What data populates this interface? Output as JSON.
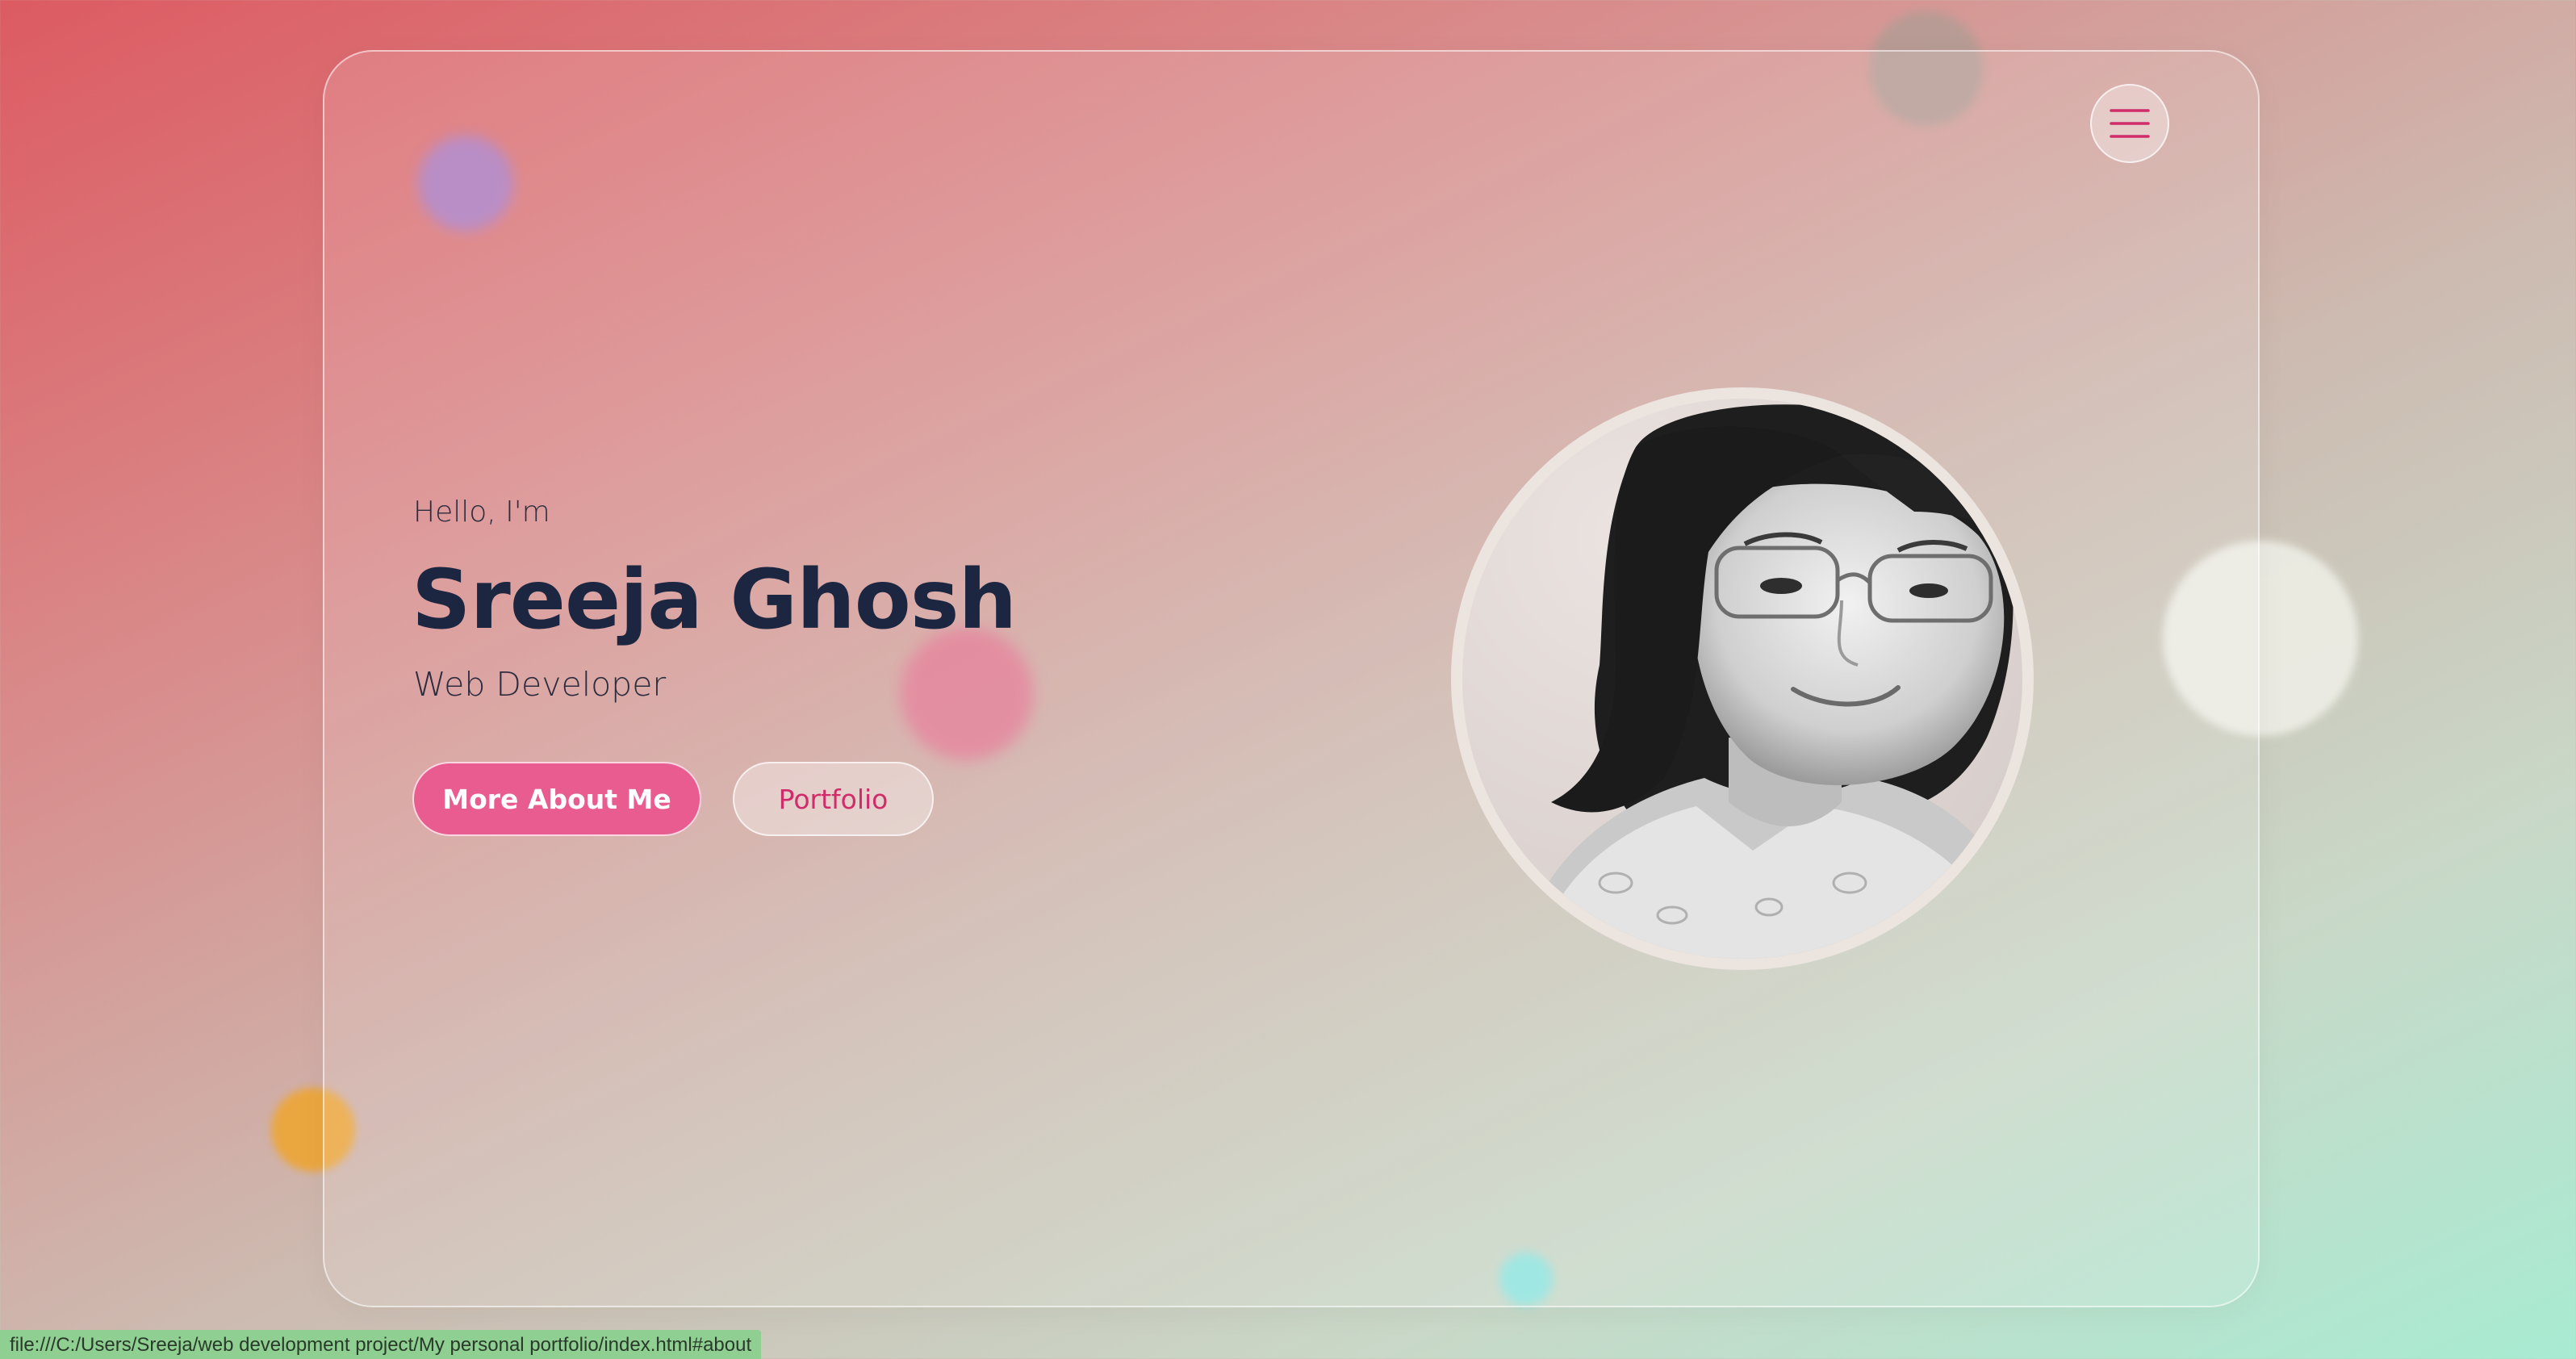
{
  "hero": {
    "greeting": "Hello, I'm",
    "name": "Sreeja Ghosh",
    "role": "Web Developer",
    "primary_button": "More About Me",
    "secondary_button": "Portfolio",
    "photo_alt": "Profile photo"
  },
  "menu": {
    "icon": "hamburger-menu-icon"
  },
  "status_bar": {
    "url": "file:///C:/Users/Sreeja/web development project/My personal portfolio/index.html#about"
  },
  "colors": {
    "accent": "#e95c8f",
    "accent_text": "#d02c6a",
    "heading": "#1d2640",
    "orange_blob": "#eca63a",
    "purple_blob": "#a77dc9",
    "cyan_blob": "#8ee4e0"
  }
}
